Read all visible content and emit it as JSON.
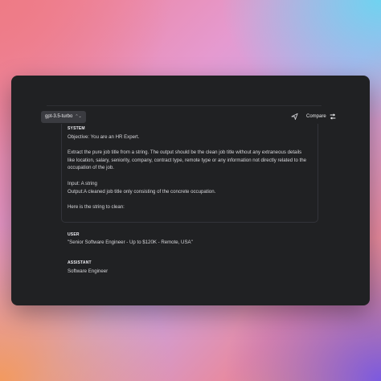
{
  "model": {
    "label": "gpt-3.5-turbo"
  },
  "header": {
    "compare_label": "Compare"
  },
  "system": {
    "role_label": "SYSTEM",
    "lines": [
      "Objective: You are an HR Expert.",
      "Extract the pure job title from a string. The output should be the clean job title without any extraneous details like location, salary, seniority, company, contract type, remote type or any information not directly related to the occupation of the job.",
      "Input: A string\nOutput:A cleaned job title only consisting of the concrete occupation.",
      "Here is the string to clean:"
    ]
  },
  "user": {
    "role_label": "USER",
    "message": "\"Senior Software Engineer - Up to $120K - Remote, USA\""
  },
  "assistant": {
    "role_label": "ASSISTANT",
    "message": "Software Engineer"
  },
  "icons": [
    "chevron-updown-icon",
    "send-icon",
    "compare-icon"
  ]
}
